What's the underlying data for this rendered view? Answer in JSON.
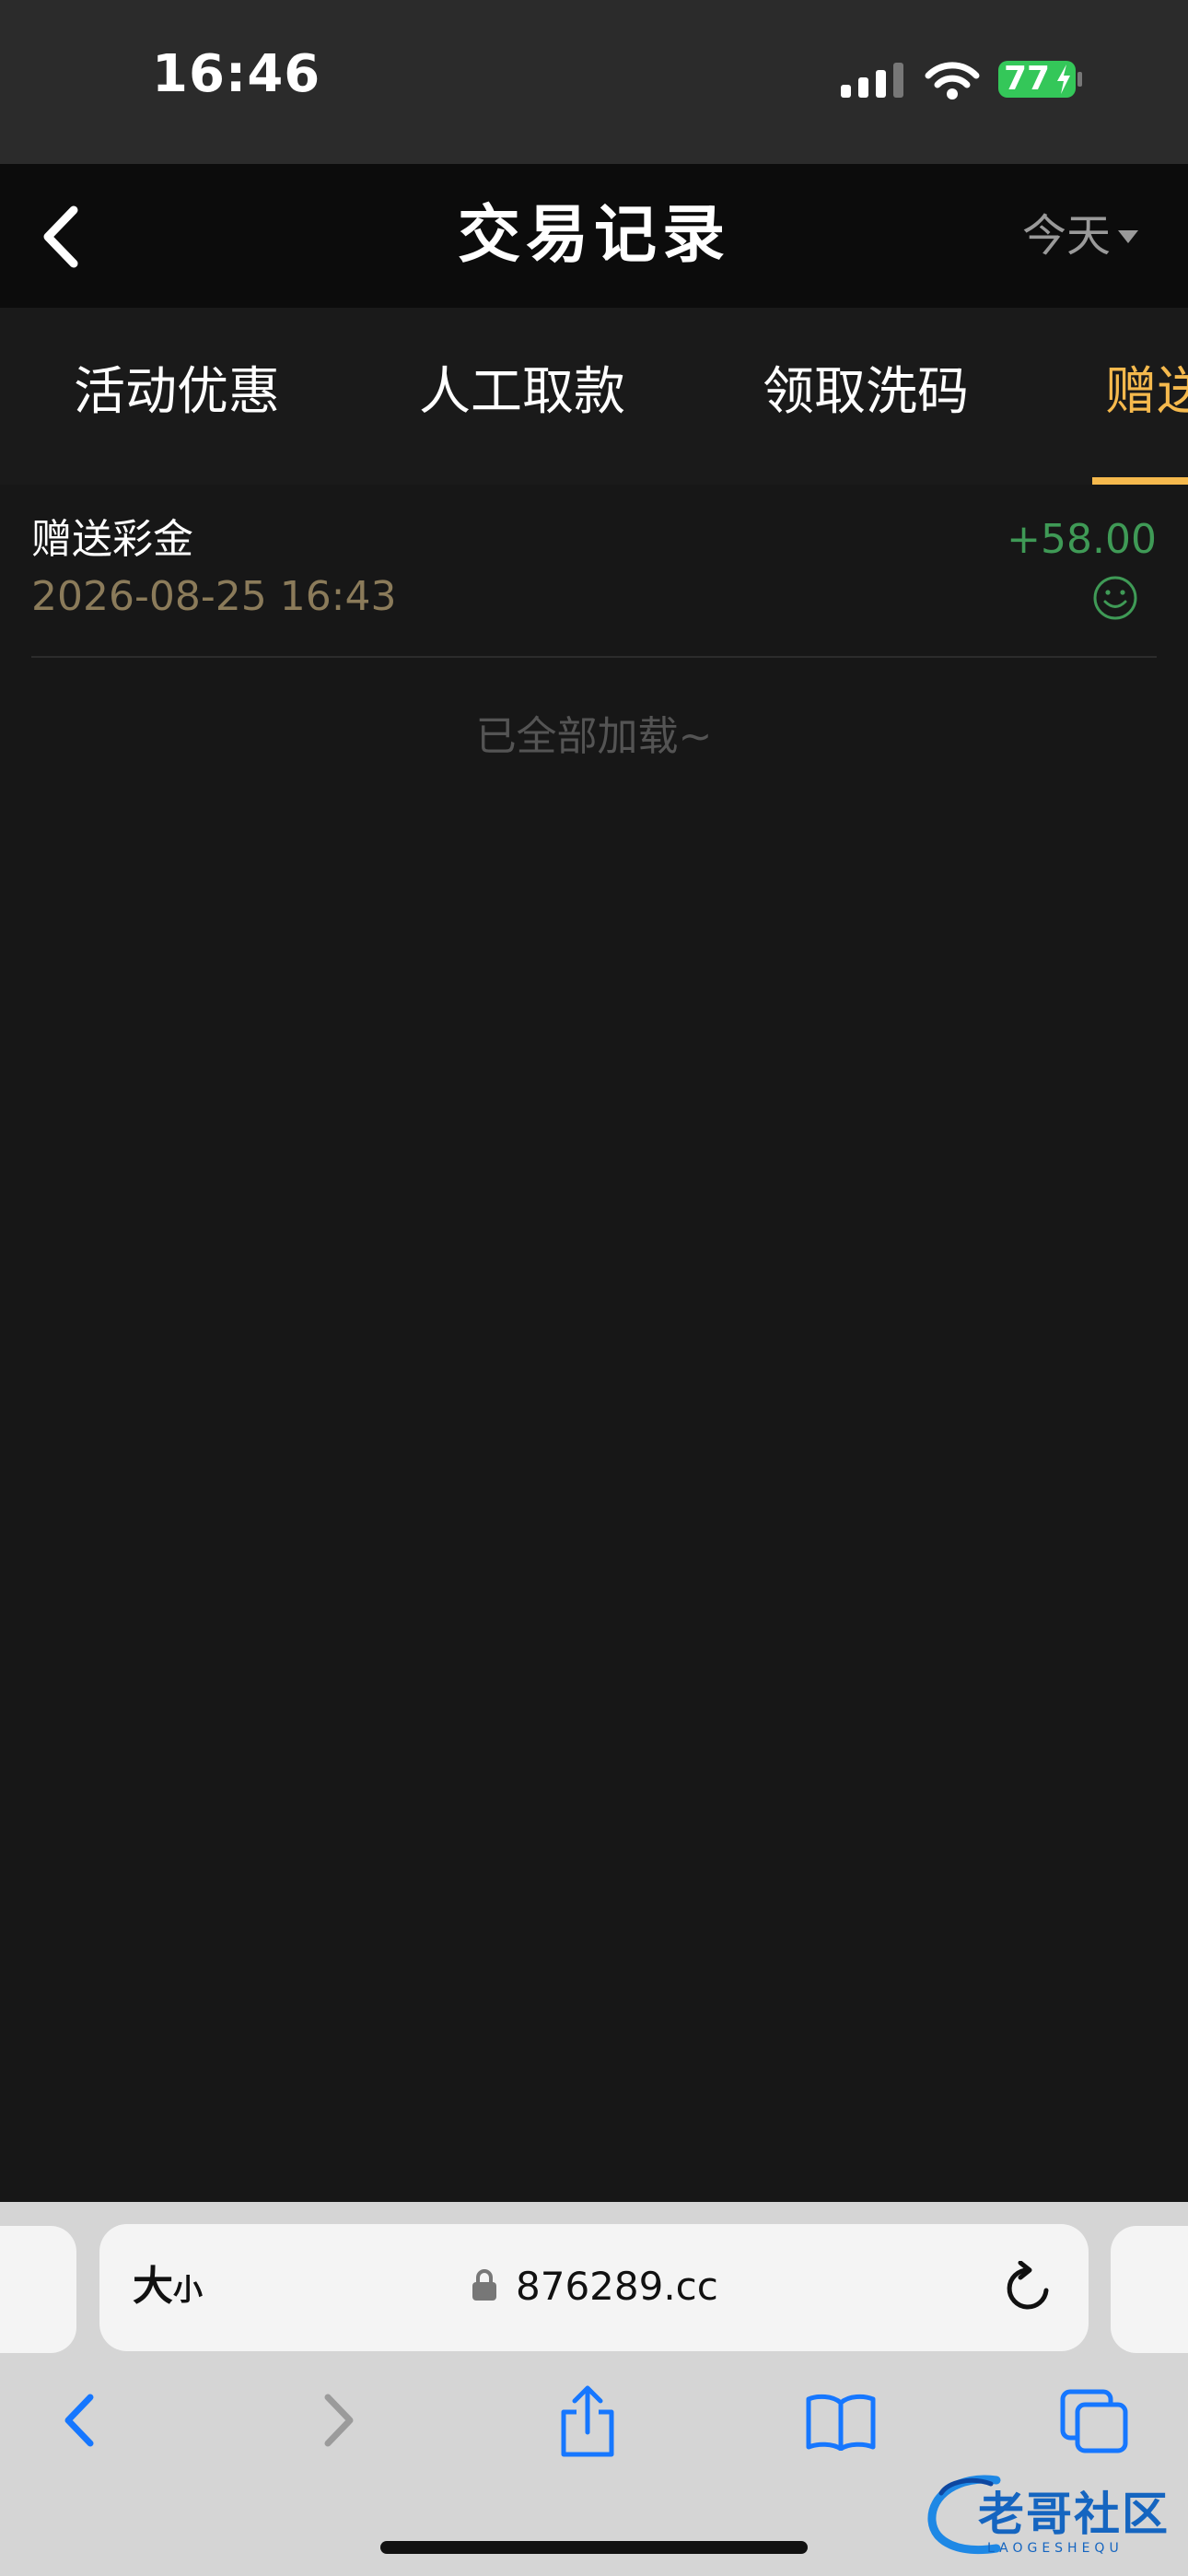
{
  "status_bar": {
    "time": "16:46",
    "battery": "77"
  },
  "header": {
    "title": "交易记录",
    "date_filter": "今天"
  },
  "tabs": [
    {
      "label": "活动优惠",
      "active": false
    },
    {
      "label": "人工取款",
      "active": false
    },
    {
      "label": "领取洗码",
      "active": false
    },
    {
      "label": "赠送",
      "active": true
    }
  ],
  "records": [
    {
      "title": "赠送彩金",
      "time": "2026-08-25 16:43",
      "amount": "+58.00",
      "status_icon": "smile-icon"
    }
  ],
  "load_status": "已全部加载~",
  "browser": {
    "text_size_label": "大",
    "text_size_small": "小",
    "url": "876289.cc"
  },
  "watermark": {
    "text": "老哥社区",
    "subtext": "LAOGESHEQU"
  },
  "colors": {
    "accent": "#f5b94d",
    "positive": "#3f9a56",
    "background": "#171717",
    "battery": "#34c759"
  }
}
